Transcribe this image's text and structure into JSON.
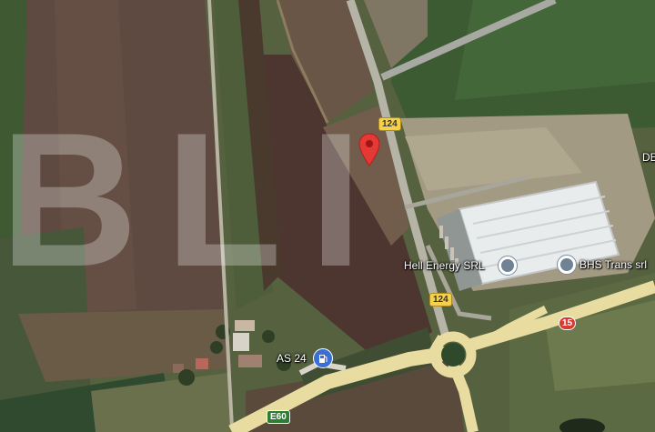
{
  "map": {
    "labels": {
      "hell_energy": "Hell Energy SRL",
      "bhs_trans": "BHS Trans srl",
      "as24": "AS 24",
      "de_partial": "DE"
    },
    "road_shields": {
      "r124_top": "124",
      "r124_bottom": "124",
      "r15": "15",
      "e60": "E60"
    },
    "watermark_text": "BLI",
    "colors": {
      "pin": "#e53935",
      "road": "#efe3a8",
      "field_green": "#556b43",
      "field_brown": "#5b4538"
    }
  }
}
